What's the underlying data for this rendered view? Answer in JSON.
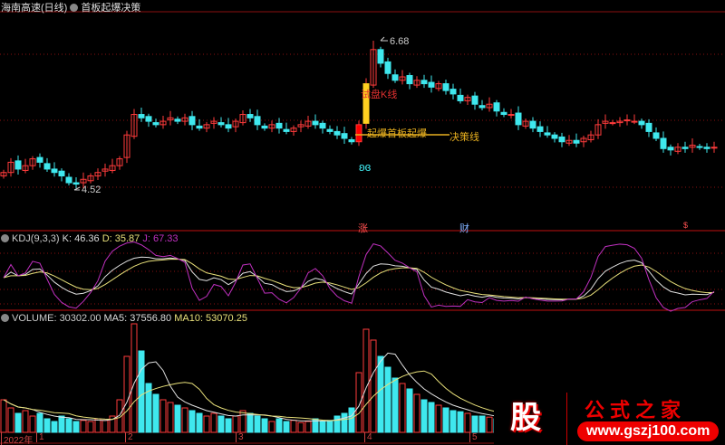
{
  "header": {
    "stock": "海南高速(日线)",
    "indicator": "首板起爆决策"
  },
  "annotations": {
    "high_label": "6.68",
    "low_label": "4.52",
    "trial_k": "试盘K线",
    "first_board": "起爆首板起爆",
    "decision": "决策线",
    "mark_zhang": "涨",
    "mark_cai": "财",
    "mark_s": "$"
  },
  "kdj": {
    "title": "KDJ(9,3,3)",
    "k": "K: 46.36",
    "d": "D: 35.87",
    "j": "J: 67.33"
  },
  "volume": {
    "title": "VOLUME: 30302.00",
    "ma5": "MA5: 37556.80",
    "ma10": "MA10: 53070.25"
  },
  "time_axis": [
    "2022年",
    "1",
    "2",
    "3",
    "4",
    "5"
  ],
  "watermark": {
    "glyph": "股",
    "name": "公式之家",
    "url": "www.gszj100.com"
  },
  "colors": {
    "up": "#ff3b3b",
    "down": "#3fe8ee",
    "k": "#e0e0e0",
    "d": "#e8e07a",
    "j": "#c030c0",
    "grid": "#8a1010"
  },
  "chart_data": {
    "type": "candlestick",
    "price_range": [
      4.3,
      6.9
    ],
    "high": 6.68,
    "low": 4.52,
    "close": [
      4.75,
      4.9,
      4.8,
      4.85,
      4.95,
      4.9,
      4.8,
      4.75,
      4.7,
      4.6,
      4.58,
      4.65,
      4.7,
      4.75,
      4.8,
      4.85,
      4.95,
      5.3,
      5.6,
      5.55,
      5.5,
      5.45,
      5.5,
      5.55,
      5.5,
      5.55,
      5.45,
      5.4,
      5.45,
      5.5,
      5.45,
      5.4,
      5.5,
      5.6,
      5.55,
      5.45,
      5.4,
      5.45,
      5.4,
      5.35,
      5.4,
      5.45,
      5.5,
      5.45,
      5.4,
      5.35,
      5.3,
      5.25,
      5.2,
      5.45,
      6.05,
      6.55,
      6.35,
      6.2,
      6.1,
      6.15,
      6.05,
      6.1,
      6.05,
      6.0,
      6.05,
      5.95,
      5.9,
      5.8,
      5.85,
      5.75,
      5.7,
      5.75,
      5.65,
      5.6,
      5.6,
      5.45,
      5.5,
      5.4,
      5.35,
      5.3,
      5.25,
      5.2,
      5.22,
      5.18,
      5.25,
      5.3,
      5.45,
      5.5,
      5.48,
      5.5,
      5.52,
      5.5,
      5.45,
      5.35,
      5.25,
      5.1,
      5.08,
      5.12,
      5.1,
      5.15,
      5.12,
      5.1,
      5.12
    ],
    "volume": [
      60,
      45,
      35,
      40,
      30,
      35,
      25,
      20,
      30,
      25,
      20,
      22,
      20,
      25,
      22,
      30,
      60,
      140,
      200,
      150,
      90,
      70,
      60,
      55,
      50,
      45,
      40,
      35,
      30,
      35,
      30,
      25,
      30,
      40,
      35,
      30,
      25,
      20,
      25,
      20,
      22,
      18,
      20,
      25,
      20,
      22,
      30,
      35,
      45,
      110,
      190,
      170,
      140,
      120,
      100,
      90,
      80,
      70,
      60,
      55,
      50,
      45,
      40,
      38,
      35,
      30,
      30,
      28,
      25,
      25,
      22,
      20,
      22,
      25,
      20,
      22,
      25,
      20,
      22,
      25,
      30,
      35,
      40,
      35,
      30,
      28,
      25,
      30,
      35,
      40,
      45,
      40,
      35,
      30,
      28,
      25,
      30,
      28,
      30
    ]
  }
}
